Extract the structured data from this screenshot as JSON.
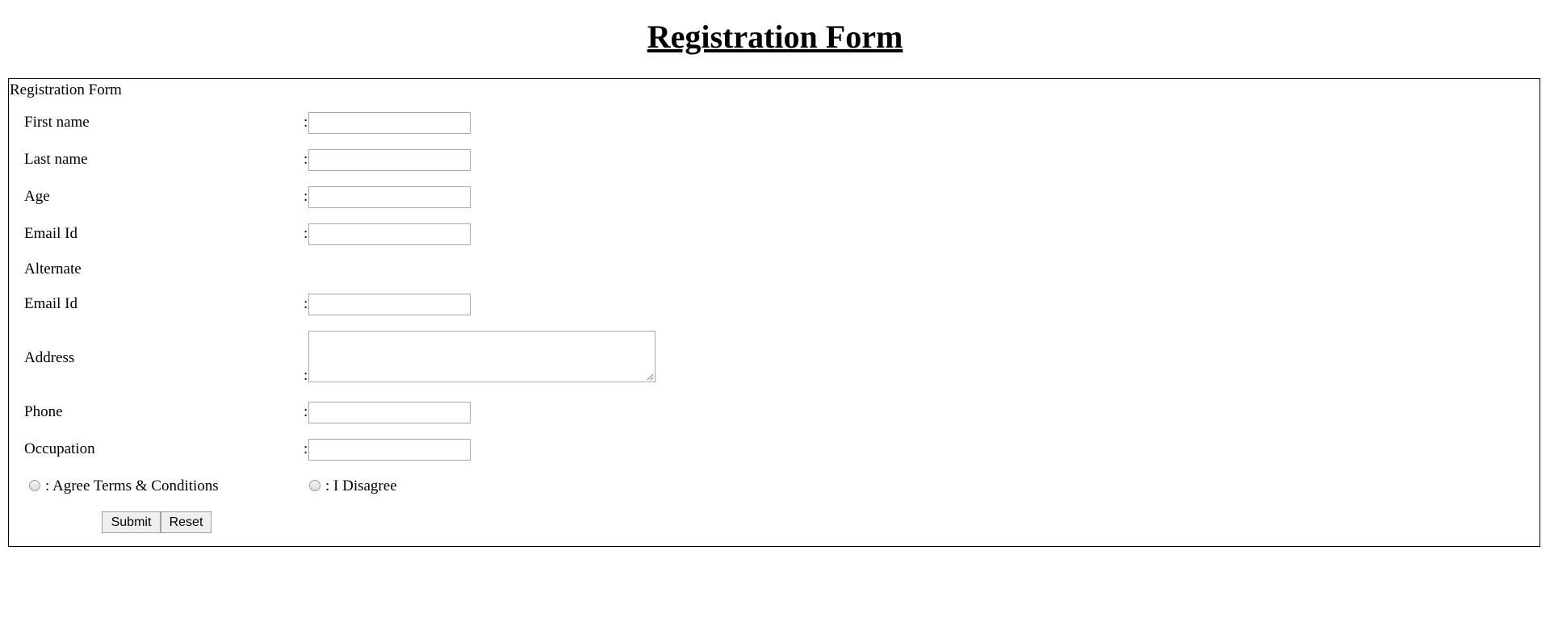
{
  "page": {
    "title": "Registration Form"
  },
  "form": {
    "caption": "Registration Form",
    "colon": ":",
    "fields": {
      "first_name": {
        "label": "First name",
        "value": ""
      },
      "last_name": {
        "label": "Last name",
        "value": ""
      },
      "age": {
        "label": "Age",
        "value": ""
      },
      "email": {
        "label": "Email Id",
        "value": ""
      },
      "alternate_heading": "Alternate",
      "alt_email": {
        "label": "Email Id",
        "value": ""
      },
      "address": {
        "label": "Address",
        "value": ""
      },
      "phone": {
        "label": "Phone",
        "value": ""
      },
      "occupation": {
        "label": "Occupation",
        "value": ""
      }
    },
    "terms": {
      "agree_label": ": Agree Terms & Conditions",
      "disagree_label": ": I Disagree",
      "selected": "none"
    },
    "buttons": {
      "submit_label": "Submit",
      "reset_label": "Reset"
    }
  },
  "colors": {
    "background": "#ffffff",
    "text": "#000000",
    "input_border": "#a9a9a9",
    "button_bg": "#efefef"
  }
}
